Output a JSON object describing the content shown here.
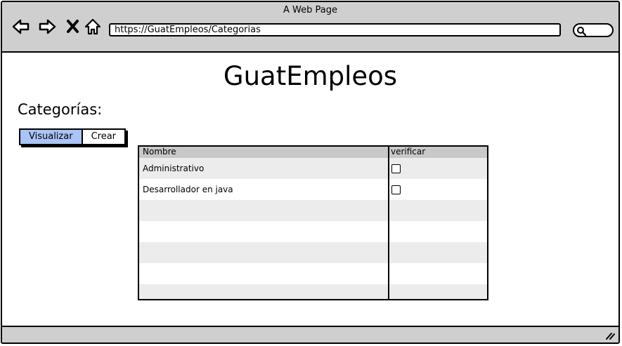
{
  "window": {
    "title": "A Web Page"
  },
  "browser": {
    "url": "https://GuatEmpleos/Categorias"
  },
  "page": {
    "title": "GuatEmpleos",
    "section": "Categorías:"
  },
  "buttons": {
    "view": "Visualizar",
    "create": "Crear"
  },
  "table": {
    "headers": [
      "Nombre",
      "verificar"
    ],
    "rows": [
      {
        "name": "Administrativo",
        "checked": false
      },
      {
        "name": "Desarrollador en java",
        "checked": false
      }
    ]
  },
  "colors": {
    "chrome": "#cfcfcf",
    "active_button": "#a9c4f5",
    "row_alt": "#ececec",
    "header": "#c8c8c8"
  }
}
